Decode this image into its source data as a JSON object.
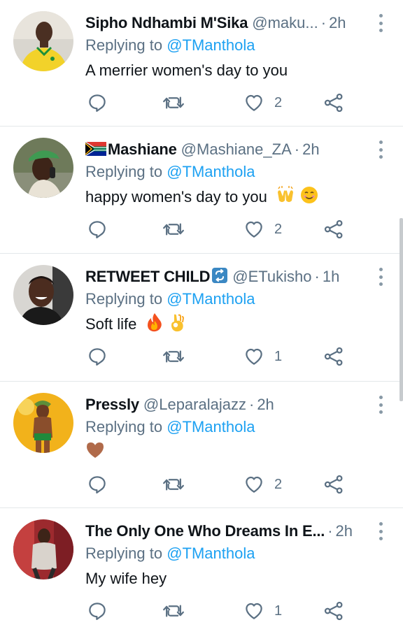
{
  "colors": {
    "accent": "#1da1f2",
    "secondary_text": "#5b7083",
    "primary_text": "#0f1419",
    "divider": "#e3e7ea"
  },
  "replies": [
    {
      "name": "Sipho Ndhambi M'Sika",
      "handle": "@maku...",
      "time": "2h",
      "replying_prefix": "Replying to",
      "replying_to": "@TManthola",
      "text": "A merrier women's day to you",
      "like_count": "2",
      "avatar_icon": "avatar-man-yellow-jersey"
    },
    {
      "name": "Mashiane",
      "handle": "@Mashiane_ZA",
      "time": "2h",
      "replying_prefix": "Replying to",
      "replying_to": "@TManthola",
      "text": "happy women's day to you",
      "emojis": [
        "raising-hands-emoji",
        "smiling-face-emoji"
      ],
      "like_count": "2",
      "avatar_icon": "avatar-person-green-cap",
      "name_prefix_icon": "south-africa-flag-icon"
    },
    {
      "name": "RETWEET CHILD",
      "handle": "@ETukisho",
      "time": "1h",
      "replying_prefix": "Replying to",
      "replying_to": "@TManthola",
      "text": "Soft life",
      "emojis": [
        "fire-emoji",
        "ok-hand-emoji"
      ],
      "like_count": "1",
      "avatar_icon": "avatar-man-smiling",
      "name_suffix_icon": "repeat-button-emoji"
    },
    {
      "name": "Pressly",
      "handle": "@Leparalajazz",
      "time": "2h",
      "replying_prefix": "Replying to",
      "replying_to": "@TManthola",
      "text": "",
      "emojis": [
        "brown-heart-emoji"
      ],
      "like_count": "2",
      "avatar_icon": "avatar-figure-yellow-background"
    },
    {
      "name": "The Only One Who Dreams In E...",
      "handle": "",
      "time": "2h",
      "replying_prefix": "Replying to",
      "replying_to": "@TManthola",
      "text": "My wife hey",
      "like_count": "1",
      "avatar_icon": "avatar-person-red-jacket"
    }
  ]
}
